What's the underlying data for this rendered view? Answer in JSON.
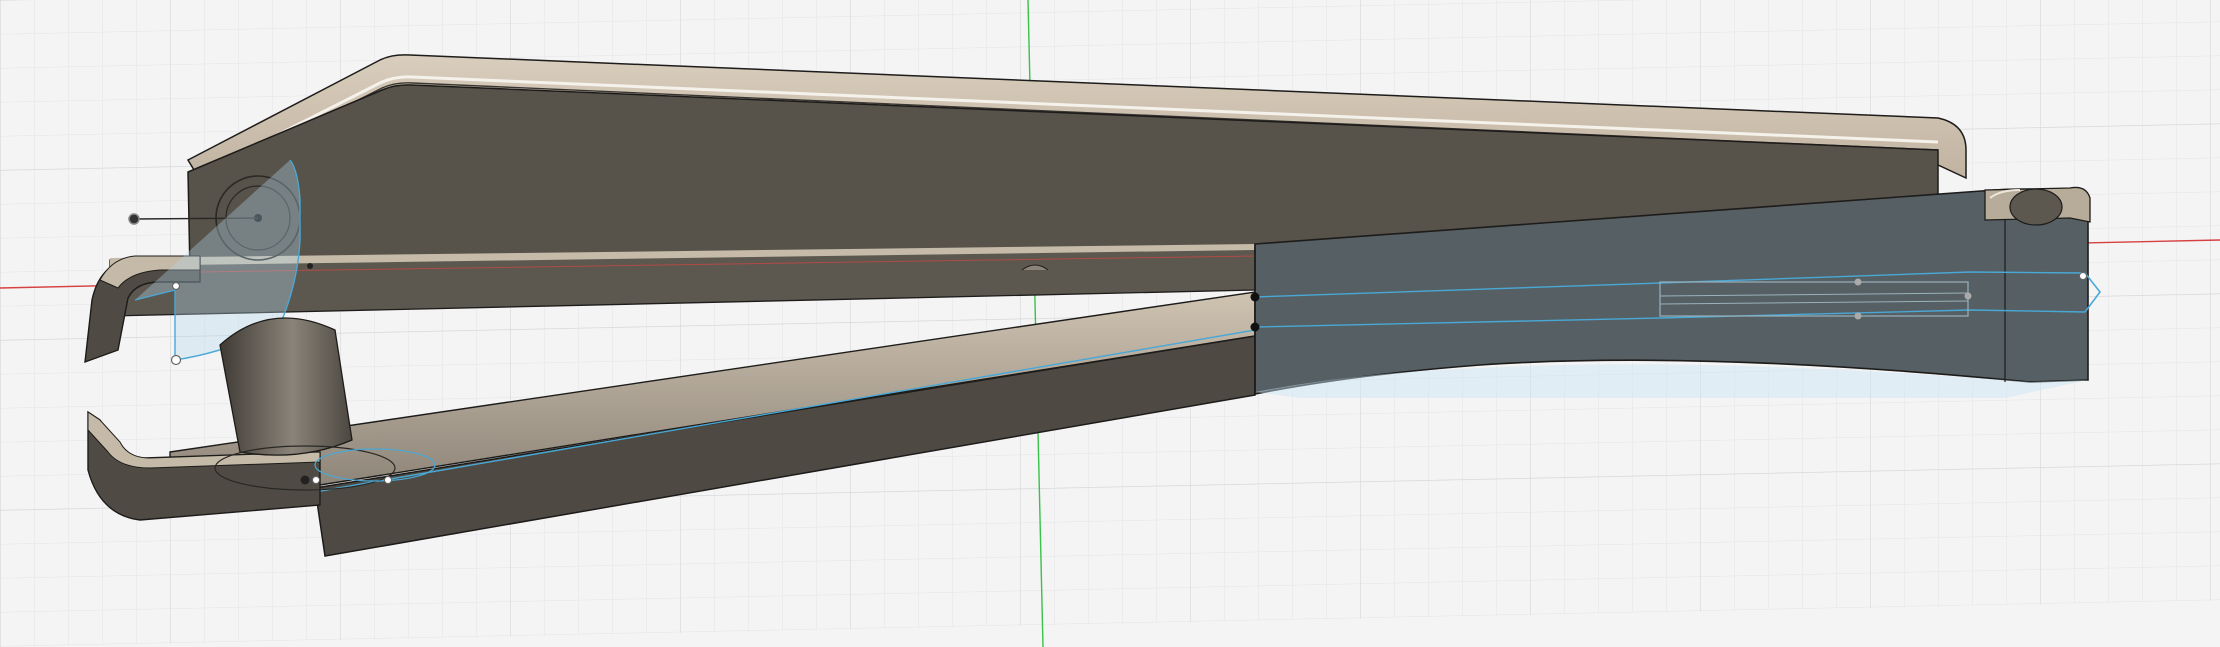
{
  "scene": {
    "view": "cad-3d-viewport",
    "model": "clip-assembly",
    "colors": {
      "background": "#f4f4f5",
      "grid_minor": "#e3e4e6",
      "grid_major": "#d0d2d5",
      "axis_x": "#d64040",
      "axis_y": "#39c14a",
      "body_top": "#c9bba8",
      "body_side": "#57524a",
      "body_dark": "#4b4740",
      "selected_face": "#566064",
      "sketch_line": "#49a8d6",
      "sketch_fill": "#cfe6f3",
      "edge": "#1d1c1a"
    },
    "icons": [
      "sketch-point-icon",
      "hinge-axis-icon",
      "sketch-profile-icon"
    ]
  }
}
